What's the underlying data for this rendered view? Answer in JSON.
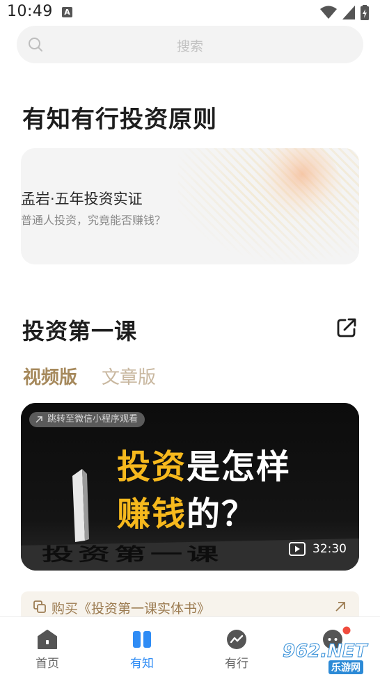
{
  "status": {
    "time": "10:49",
    "notif_letter": "A"
  },
  "search": {
    "placeholder": "搜索"
  },
  "section1": {
    "title": "有知有行投资原则",
    "card": {
      "title": "孟岩·五年投资实证",
      "subtitle": "普通人投资，究竟能否赚钱？"
    }
  },
  "section2": {
    "title": "投资第一课",
    "tabs": [
      {
        "label": "视频版",
        "active": true
      },
      {
        "label": "文章版",
        "active": false
      }
    ],
    "video": {
      "mini_tag": "跳转至微信小程序观看",
      "headline": [
        {
          "yellow": "投资",
          "white": "是怎样"
        },
        {
          "yellow": "赚钱",
          "white": "的？"
        }
      ],
      "background_text": "投资第一课",
      "duration": "32:30"
    },
    "buy_label": "购买《投资第一课实体书》"
  },
  "nav": [
    {
      "label": "首页",
      "icon": "home-icon",
      "active": false
    },
    {
      "label": "有知",
      "icon": "book-icon",
      "active": true
    },
    {
      "label": "有行",
      "icon": "chart-icon",
      "active": false
    },
    {
      "label": "",
      "icon": "chat-icon",
      "active": false
    }
  ],
  "watermark": {
    "brand": "962.NET",
    "sub": "乐游网"
  },
  "colors": {
    "accent_gold": "#a6895c",
    "accent_blue": "#2f8cf5",
    "highlight_yellow": "#f7b91d"
  }
}
